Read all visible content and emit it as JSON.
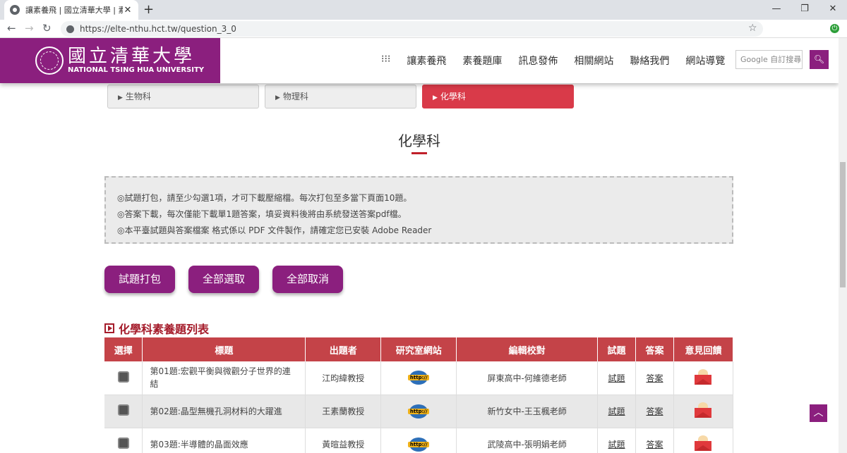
{
  "browser": {
    "tab_title": "讓素養飛 | 國立清華大學 | 素養題",
    "tab_close": "✕",
    "new_tab": "+",
    "url": "https://elte-nthu.hct.tw/question_3_0",
    "win_min": "—",
    "win_max": "❐",
    "win_close": "✕"
  },
  "header": {
    "logo_cn": "國立清華大學",
    "logo_en": "NATIONAL TSING HUA UNIVERSITY",
    "menu": [
      "⁝⁝⁝",
      "讓素養飛",
      "素養題庫",
      "訊息發佈",
      "相關網站",
      "聯絡我們",
      "網站導覽"
    ],
    "search_placeholder": "Google 自訂搜尋",
    "search_icon": "search-icon"
  },
  "subject_tabs": [
    "生物科",
    "物理科",
    "化學科"
  ],
  "active_subject": "化學科",
  "page_title": "化學科",
  "notices": [
    "◎試題打包，請至少勾選1項，才可下載壓縮檔。每次打包至多當下頁面10題。",
    "◎答案下載，每次僅能下載單1題答案，填妥資料後將由系統發送答案pdf檔。",
    "◎本平臺試題與答案檔案 格式係以 PDF 文件製作，請確定您已安裝 Adobe Reader"
  ],
  "actions": [
    "試題打包",
    "全部選取",
    "全部取消"
  ],
  "list_title": "化學科素養題列表",
  "table": {
    "headers": [
      "選擇",
      "標題",
      "出題者",
      "研究室網站",
      "編輯校對",
      "試題",
      "答案",
      "意見回饋"
    ],
    "rows": [
      {
        "title": "第01題:宏觀平衡與微觀分子世界的連結",
        "author": "江昀緯教授",
        "editor": "屏東高中-何維德老師",
        "q": "試題",
        "a": "答案"
      },
      {
        "title": "第02題:晶型無機孔洞材料的大躍進",
        "author": "王素蘭教授",
        "editor": "新竹女中-王玉楓老師",
        "q": "試題",
        "a": "答案"
      },
      {
        "title": "第03題:半導體的晶面效應",
        "author": "黃暄益教授",
        "editor": "武陵高中-張明娟老師",
        "q": "試題",
        "a": "答案"
      }
    ],
    "http_label": "http://"
  },
  "colors": {
    "brand": "#8b1f7e",
    "active_tab": "#d93a49",
    "table_header": "#c44348"
  }
}
